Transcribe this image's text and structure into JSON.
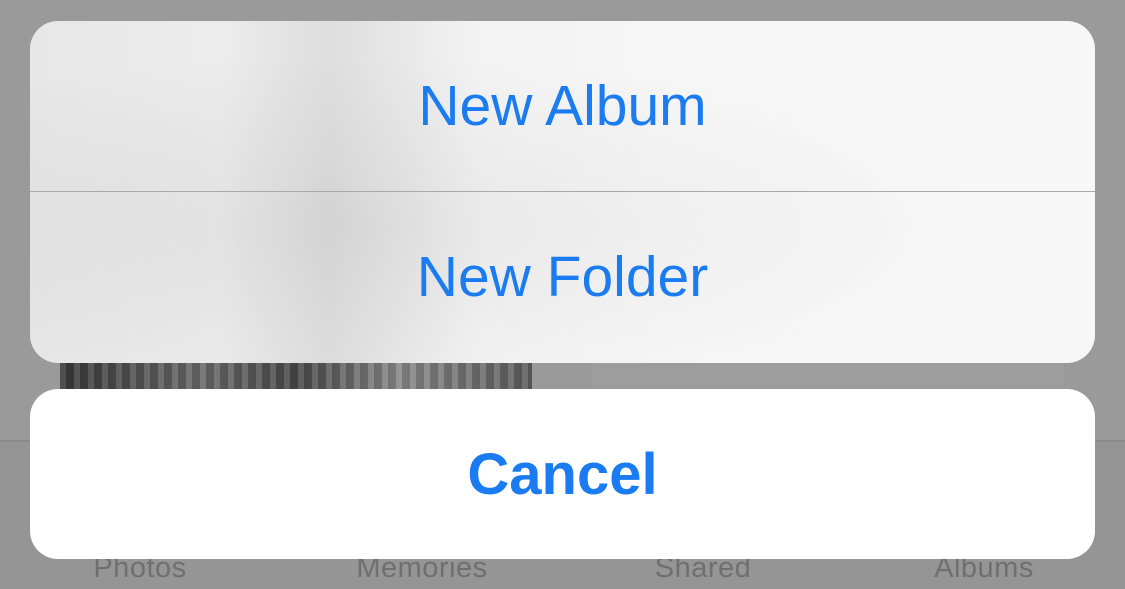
{
  "action_sheet": {
    "items": [
      {
        "label": "New Album"
      },
      {
        "label": "New Folder"
      }
    ],
    "cancel_label": "Cancel"
  },
  "background_tab_bar": {
    "tabs": [
      {
        "label": "Photos"
      },
      {
        "label": "Memories"
      },
      {
        "label": "Shared"
      },
      {
        "label": "Albums"
      }
    ]
  },
  "colors": {
    "accent": "#1a7cf0",
    "sheet_background": "#f7f7f7",
    "cancel_background": "#ffffff",
    "dim_overlay": "#8f8f8f"
  }
}
